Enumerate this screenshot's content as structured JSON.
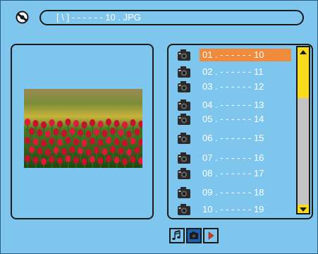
{
  "header": {
    "disc_icon": "no-disc-icon",
    "path": "[ \\ ] - - - - - - 10 . JPG"
  },
  "preview": {
    "image": "tulip-field-thumbnail"
  },
  "file_list": {
    "item_icon": "jpeg-camera-icon",
    "selected_index": 0,
    "items": [
      {
        "label": "01 . - - - - - - 10"
      },
      {
        "label": "02 . - - - - - - 11"
      },
      {
        "label": "03 . - - - - - - 12"
      },
      {
        "label": "04 . - - - - - - 13"
      },
      {
        "label": "05 . - - - - - - 14"
      },
      {
        "label": "06 . - - - - - - 15"
      },
      {
        "label": "07 . - - - - - - 16"
      },
      {
        "label": "08 . - - - - - - 17"
      },
      {
        "label": "09 . - - - - - - 18"
      },
      {
        "label": "10 . - - - - - - 19"
      }
    ],
    "scroll_position": 0
  },
  "mode_buttons": [
    {
      "icon": "music-note-icon",
      "active": false
    },
    {
      "icon": "photo-icon",
      "active": true
    },
    {
      "icon": "video-play-icon",
      "active": false
    }
  ],
  "colors": {
    "background": "#7fc6ee",
    "selection": "#f08a3c",
    "scrollbar": "#f6dc1c",
    "active_mode": "#1d5fb0"
  }
}
